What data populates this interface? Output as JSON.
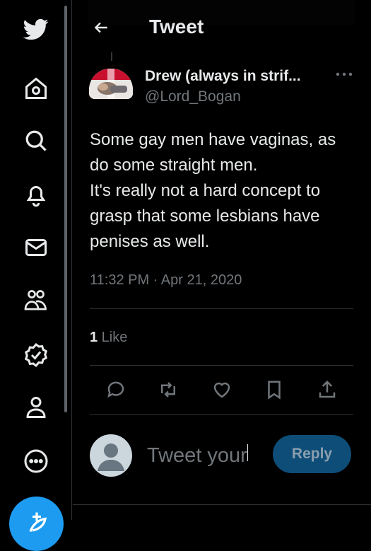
{
  "header": {
    "title": "Tweet"
  },
  "tweet": {
    "author_name": "Drew (always in strif...",
    "author_handle": "@Lord_Bogan",
    "text_lines": [
      "Some gay men have vaginas, as",
      "do some straight men.",
      "It's really not a hard concept to",
      "grasp that some lesbians have",
      "penises as well."
    ],
    "timestamp": "11:32 PM · Apr 21, 2020",
    "like_count": "1",
    "like_label": " Like"
  },
  "reply": {
    "placeholder": "Tweet your",
    "button_label": "Reply"
  },
  "nav": {
    "items": [
      "twitter-logo",
      "home-icon",
      "search-icon",
      "notifications-icon",
      "messages-icon",
      "communities-icon",
      "verified-icon",
      "profile-icon",
      "more-icon"
    ]
  },
  "colors": {
    "accent": "#1d9bf0",
    "background": "#000000",
    "secondary_text": "#71767b"
  }
}
